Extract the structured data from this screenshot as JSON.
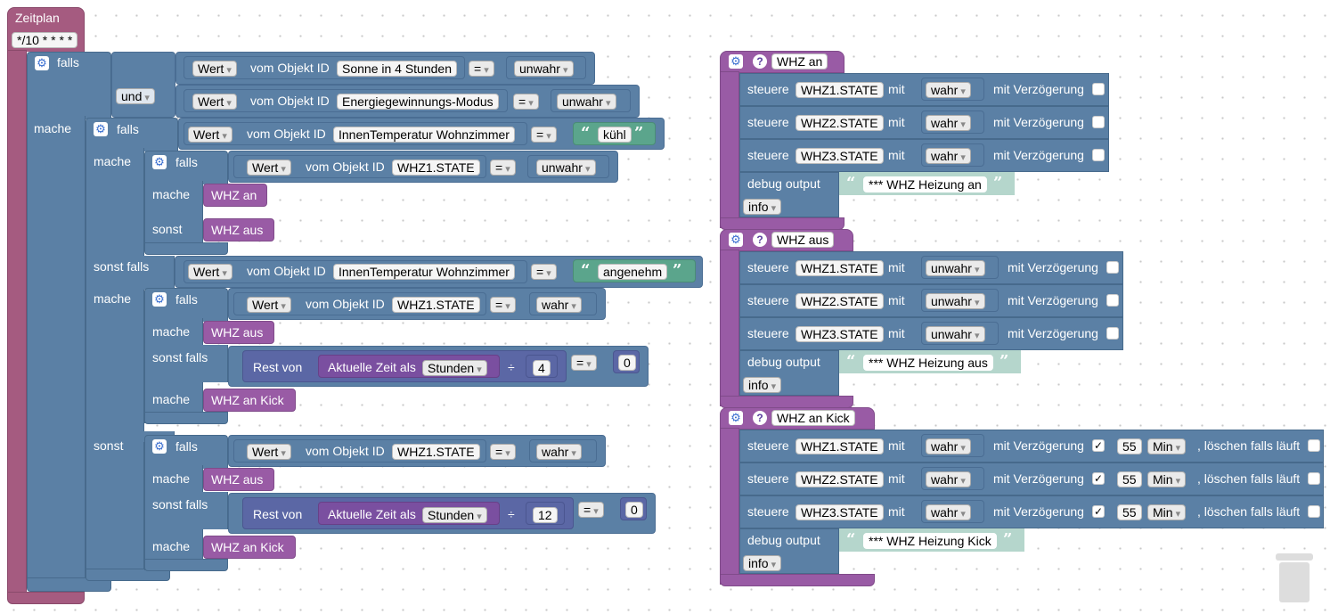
{
  "main_event": {
    "title": "Zeitplan",
    "cron": "*/10 * * * *"
  },
  "kw": {
    "if": "falls",
    "and": "und",
    "do": "mache",
    "else_if": "sonst falls",
    "else": "sonst",
    "value": "Wert",
    "of_object": "vom Objekt ID",
    "equals": "=",
    "rest_of": "Rest von",
    "div": "÷",
    "current_time_as": "Aktuelle Zeit als",
    "hours": "Stunden",
    "control": "steuere",
    "with": "mit",
    "with_delay": "mit Verzögerung",
    "clear_running": ", löschen falls läuft",
    "min": "Min",
    "debug_output": "debug output",
    "info": "info",
    "true": "wahr",
    "false": "unwahr",
    "open_quote": "“",
    "close_quote": "”"
  },
  "cond": {
    "sun": "Sonne in 4 Stunden",
    "energy": "Energiegewinnungs-Modus",
    "temp": "InnenTemperatur Wohnzimmer",
    "whz1": "WHZ1.STATE",
    "cool": "kühl",
    "pleasant": "angenehm",
    "n4": "4",
    "n12": "12",
    "n0": "0"
  },
  "calls": {
    "on": "WHZ an",
    "off": "WHZ aus",
    "kick": "WHZ an Kick"
  },
  "functions": [
    {
      "title": "WHZ an",
      "rows": [
        {
          "obj": "WHZ1.STATE",
          "val": "wahr"
        },
        {
          "obj": "WHZ2.STATE",
          "val": "wahr"
        },
        {
          "obj": "WHZ3.STATE",
          "val": "wahr"
        }
      ],
      "debug": "*** WHZ Heizung an"
    },
    {
      "title": "WHZ aus",
      "rows": [
        {
          "obj": "WHZ1.STATE",
          "val": "unwahr"
        },
        {
          "obj": "WHZ2.STATE",
          "val": "unwahr"
        },
        {
          "obj": "WHZ3.STATE",
          "val": "unwahr"
        }
      ],
      "debug": "*** WHZ Heizung aus"
    },
    {
      "title": "WHZ an Kick",
      "rows": [
        {
          "obj": "WHZ1.STATE",
          "val": "wahr",
          "delay": "55"
        },
        {
          "obj": "WHZ2.STATE",
          "val": "wahr",
          "delay": "55"
        },
        {
          "obj": "WHZ3.STATE",
          "val": "wahr",
          "delay": "55"
        }
      ],
      "debug": "*** WHZ Heizung Kick"
    }
  ],
  "icons": {
    "gear": "gear-icon",
    "help": "help-icon",
    "trash": "trash-icon",
    "check": "checkmark-icon"
  },
  "colors": {
    "event": "#a55b80",
    "logic": "#5b80a5",
    "text": "#5ba58c",
    "math": "#5b67a5",
    "procedure": "#995ba5",
    "workspace": "#ffffff"
  }
}
